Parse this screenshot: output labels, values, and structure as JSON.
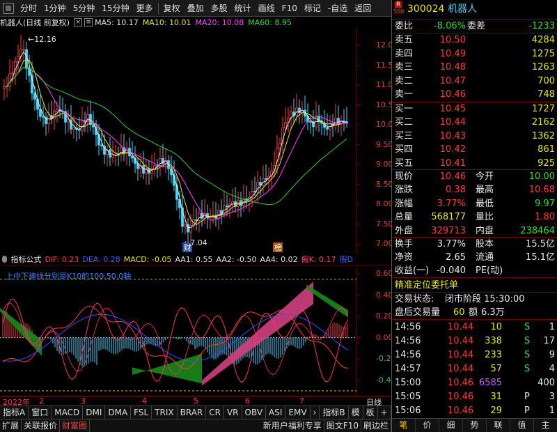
{
  "toolbar": {
    "items": [
      "分时",
      "1分钟",
      "5分钟",
      "15分钟",
      "更多",
      "复权",
      "叠加",
      "多股",
      "统计",
      "画线",
      "F10",
      "标记",
      "-自选",
      "返回"
    ]
  },
  "chart_title": {
    "name": "机器人(日线 前复权)",
    "ma5": "MA5: 10.17",
    "ma10": "MA10: 10.01",
    "ma20": "MA20: 10.08",
    "ma60": "MA60: 8.95",
    "high_mark": "12.16",
    "low_mark": "7.04",
    "badge_cai": "财",
    "badge_bang": "榜"
  },
  "price_axis": [
    "12.00",
    "11.50",
    "11.00",
    "10.50",
    "10.00",
    "9.50",
    "9.00",
    "8.50",
    "8.00",
    "7.50",
    "7.00"
  ],
  "indicator": {
    "name": "指标公式",
    "dif": "DIF: 0.23",
    "dea": "DEA: 0.28",
    "macd": "MACD: -0.05",
    "aa1": "AA1: 0.55",
    "aa2": "AA2: -0.50",
    "aa4": "AA4: 0.02",
    "jk": "假K: 0.17",
    "jd": "假D",
    "note": "上中下建线分别是K10的100,50,0轴"
  },
  "ind_axis": [
    "0.60",
    "0.40",
    "0.20",
    "0.00",
    "-0.20",
    "-0.40"
  ],
  "date_row": {
    "year": "2022年",
    "months": [
      "2",
      "3",
      "4",
      "5",
      "6",
      "7"
    ],
    "period": "日线"
  },
  "tabs1": [
    "指标A",
    "窗口",
    "MACD",
    "DMI",
    "DMA",
    "FSL",
    "TRIX",
    "BRAR",
    "CR",
    "VR",
    "OBV",
    "ASI",
    "EMV",
    "›",
    "指标B",
    "模",
    "板",
    "+",
    "−"
  ],
  "tabs2": [
    "扩展",
    "关联报价",
    "财富圈",
    "新用户福利专享",
    "图文F10",
    "刷边栏"
  ],
  "right_panel": {
    "code": "300024",
    "name": "机器人",
    "r_badge": "R",
    "sub_badge": "500",
    "weibi_label": "委比",
    "weibi": "-8.06%",
    "weicha_label": "委差",
    "weicha": "-1233",
    "asks": [
      {
        "label": "卖五",
        "price": "10.50",
        "vol": "4284"
      },
      {
        "label": "卖四",
        "price": "10.49",
        "vol": "1275"
      },
      {
        "label": "卖三",
        "price": "10.48",
        "vol": "1263"
      },
      {
        "label": "卖二",
        "price": "10.47",
        "vol": "700"
      },
      {
        "label": "卖一",
        "price": "10.46",
        "vol": "748"
      }
    ],
    "bids": [
      {
        "label": "买一",
        "price": "10.45",
        "vol": "1727"
      },
      {
        "label": "买二",
        "price": "10.44",
        "vol": "2162"
      },
      {
        "label": "买三",
        "price": "10.43",
        "vol": "1362"
      },
      {
        "label": "买四",
        "price": "10.42",
        "vol": "861"
      },
      {
        "label": "买五",
        "price": "10.41",
        "vol": "925"
      }
    ],
    "stats": [
      {
        "l1": "现价",
        "v1": "10.46",
        "l2": "今开",
        "v2": "10.00"
      },
      {
        "l1": "涨跌",
        "v1": "0.38",
        "l2": "最高",
        "v2": "10.68"
      },
      {
        "l1": "涨幅",
        "v1": "3.77%",
        "l2": "最低",
        "v2": "9.97"
      },
      {
        "l1": "总量",
        "v1": "568177",
        "l2": "量比",
        "v2": "1.80"
      },
      {
        "l1": "外盘",
        "v1": "329713",
        "l2": "内盘",
        "v2": "238464"
      }
    ],
    "stats2": [
      {
        "l1": "换手",
        "v1": "3.77%",
        "l2": "股本",
        "v2": "15.5亿"
      },
      {
        "l1": "净资",
        "v1": "2.65",
        "l2": "流通",
        "v2": "15.1亿"
      },
      {
        "l1": "收益(一)",
        "v1": "-0.040",
        "l2": "PE(动)",
        "v2": ""
      }
    ],
    "section_title": "精准定位委托单",
    "status_label": "交易状态:",
    "status_value": "闭市阶段 15:30:00",
    "after_label": "盘后交易量",
    "after_vol": "60",
    "after_amt_label": "额",
    "after_amt": "6.3万",
    "ticks": [
      {
        "t": "14:56",
        "p": "10.44",
        "v": "10",
        "s": "S",
        "n": "1"
      },
      {
        "t": "14:56",
        "p": "10.44",
        "v": "338",
        "s": "S",
        "n": "17"
      },
      {
        "t": "14:56",
        "p": "10.44",
        "v": "233",
        "s": "S",
        "n": "9"
      },
      {
        "t": "14:57",
        "p": "10.44",
        "v": "57",
        "s": "S",
        "n": "4"
      },
      {
        "t": "15:00",
        "p": "10.46",
        "v": "6585",
        "s": "",
        "n": "400"
      },
      {
        "t": "15:05",
        "p": "10.46",
        "v": "31",
        "s": "P",
        "n": "3"
      },
      {
        "t": "15:06",
        "p": "10.46",
        "v": "29",
        "s": "P",
        "n": "1"
      }
    ],
    "bottom_tabs": [
      "笔",
      "价",
      "细",
      "势",
      "联",
      "值",
      "主"
    ]
  },
  "chart_data": {
    "type": "candlestick",
    "y_range": [
      6.9,
      12.3
    ],
    "ma_colors": {
      "ma5": "#e8e8e8",
      "ma10": "#e8e800",
      "ma20": "#ff40ff",
      "ma60": "#33cc33"
    },
    "indicator_range": [
      -0.52,
      0.66
    ]
  }
}
